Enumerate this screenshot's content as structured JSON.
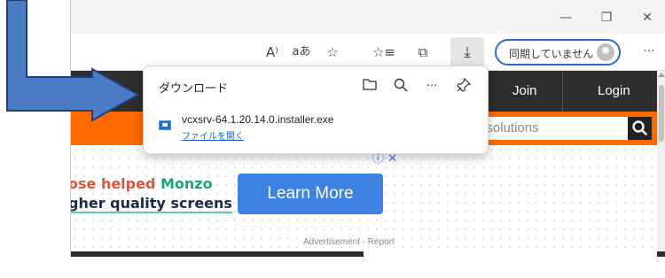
{
  "window": {
    "controls": {
      "minimize": "—",
      "restore": "❐",
      "close": "✕"
    }
  },
  "toolbar": {
    "read_aloud": "A⁾",
    "translate": "aあ",
    "add_favorite": "☆",
    "favorites": "☆≡",
    "collections": "⧉",
    "downloads": "⤓",
    "profile_label": "同期していません",
    "more": "···"
  },
  "download_panel": {
    "title": "ダウンロード",
    "file_name": "vcxsrv-64.1.20.14.0.installer.exe",
    "open_file_label": "ファイルを開く",
    "icons": {
      "folder": "🗀",
      "search": "⌕",
      "more": "···",
      "pin": "⚲"
    }
  },
  "site": {
    "nav": {
      "join": "Join",
      "login": "Login"
    },
    "search_placeholder": "software or solutions",
    "ad": {
      "line1_part1": "ose helped ",
      "line1_part2": "Monzo",
      "line2": "gher quality screens",
      "cta": "Learn More",
      "adchoices": "ⓘ ✕",
      "report": "Advertisement - Report"
    }
  },
  "colors": {
    "accent_orange": "#ff6a00",
    "nav_dark": "#2e2e2e",
    "cta_blue": "#3d82e0",
    "profile_border": "#2d6bc9",
    "annotation_arrow": "#4a7bc4"
  }
}
